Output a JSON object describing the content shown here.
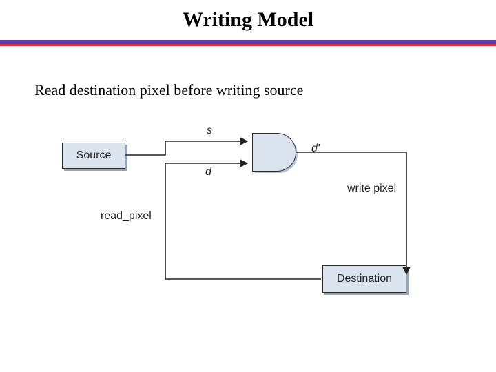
{
  "title": "Writing Model",
  "subtitle": "Read destination pixel before writing source",
  "diagram": {
    "source_label": "Source",
    "dest_label": "Destination",
    "signal_s": "s",
    "signal_d": "d",
    "signal_dprime": "d'",
    "read_label": "read_pixel",
    "write_label": "write pixel"
  }
}
